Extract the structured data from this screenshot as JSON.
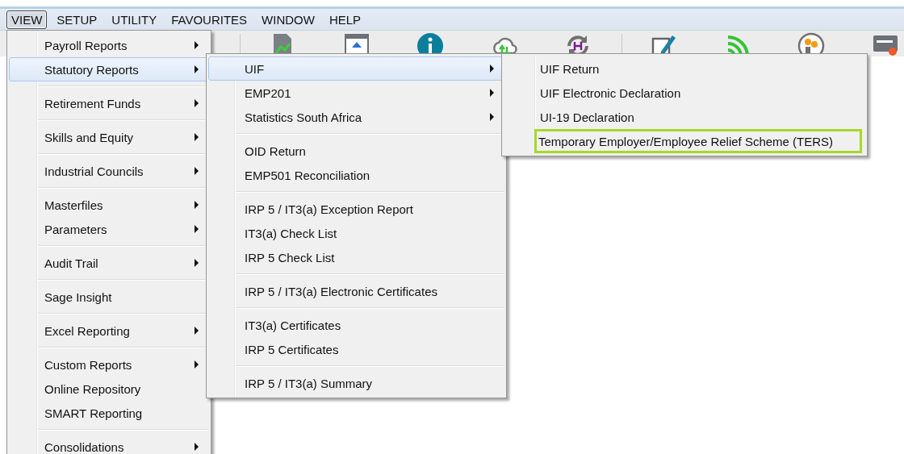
{
  "menubar": [
    {
      "label": "VIEW",
      "selected": true
    },
    {
      "label": "SETUP",
      "selected": false
    },
    {
      "label": "UTILITY",
      "selected": false
    },
    {
      "label": "FAVOURITES",
      "selected": false
    },
    {
      "label": "WINDOW",
      "selected": false
    },
    {
      "label": "HELP",
      "selected": false
    }
  ],
  "view_menu": {
    "groups": [
      {
        "items": [
          {
            "label": "Payroll Reports",
            "has_submenu": true,
            "selected": false
          },
          {
            "label": "Statutory Reports",
            "has_submenu": true,
            "selected": true
          }
        ]
      },
      {
        "items": [
          {
            "label": "Retirement Funds",
            "has_submenu": true,
            "selected": false
          }
        ]
      },
      {
        "items": [
          {
            "label": "Skills and Equity",
            "has_submenu": true,
            "selected": false
          }
        ]
      },
      {
        "items": [
          {
            "label": "Industrial Councils",
            "has_submenu": true,
            "selected": false
          }
        ]
      },
      {
        "items": [
          {
            "label": "Masterfiles",
            "has_submenu": true,
            "selected": false
          },
          {
            "label": "Parameters",
            "has_submenu": true,
            "selected": false
          }
        ]
      },
      {
        "items": [
          {
            "label": "Audit Trail",
            "has_submenu": true,
            "selected": false
          }
        ]
      },
      {
        "items": [
          {
            "label": "Sage Insight",
            "has_submenu": false,
            "selected": false
          }
        ]
      },
      {
        "items": [
          {
            "label": "Excel Reporting",
            "has_submenu": true,
            "selected": false
          }
        ]
      },
      {
        "items": [
          {
            "label": "Custom Reports",
            "has_submenu": true,
            "selected": false
          },
          {
            "label": "Online Repository",
            "has_submenu": false,
            "selected": false
          },
          {
            "label": "SMART Reporting",
            "has_submenu": false,
            "selected": false
          }
        ]
      },
      {
        "items": [
          {
            "label": "Consolidations",
            "has_submenu": true,
            "selected": false
          }
        ]
      }
    ]
  },
  "statutory_menu": {
    "groups": [
      {
        "items": [
          {
            "label": "UIF",
            "has_submenu": true,
            "selected": true
          },
          {
            "label": "EMP201",
            "has_submenu": true,
            "selected": false
          },
          {
            "label": "Statistics South Africa",
            "has_submenu": true,
            "selected": false
          }
        ]
      },
      {
        "items": [
          {
            "label": "OID Return",
            "has_submenu": false,
            "selected": false
          },
          {
            "label": "EMP501 Reconciliation",
            "has_submenu": false,
            "selected": false
          }
        ]
      },
      {
        "items": [
          {
            "label": "IRP 5 / IT3(a) Exception Report",
            "has_submenu": false,
            "selected": false
          },
          {
            "label": "IT3(a) Check List",
            "has_submenu": false,
            "selected": false
          },
          {
            "label": "IRP 5 Check List",
            "has_submenu": false,
            "selected": false
          }
        ]
      },
      {
        "items": [
          {
            "label": "IRP 5 / IT3(a) Electronic Certificates",
            "has_submenu": false,
            "selected": false
          }
        ]
      },
      {
        "items": [
          {
            "label": "IT3(a) Certificates",
            "has_submenu": false,
            "selected": false
          },
          {
            "label": "IRP 5 Certificates",
            "has_submenu": false,
            "selected": false
          }
        ]
      },
      {
        "items": [
          {
            "label": "IRP 5 / IT3(a) Summary",
            "has_submenu": false,
            "selected": false
          }
        ]
      }
    ]
  },
  "uif_menu": {
    "groups": [
      {
        "items": [
          {
            "label": "UIF Return",
            "has_submenu": false,
            "selected": false,
            "highlighted": false
          },
          {
            "label": "UIF Electronic Declaration",
            "has_submenu": false,
            "selected": false,
            "highlighted": false
          },
          {
            "label": "UI-19 Declaration",
            "has_submenu": false,
            "selected": false,
            "highlighted": false
          },
          {
            "label": "Temporary Employer/Employee Relief Scheme (TERS)",
            "has_submenu": false,
            "selected": false,
            "highlighted": true
          }
        ]
      }
    ]
  }
}
